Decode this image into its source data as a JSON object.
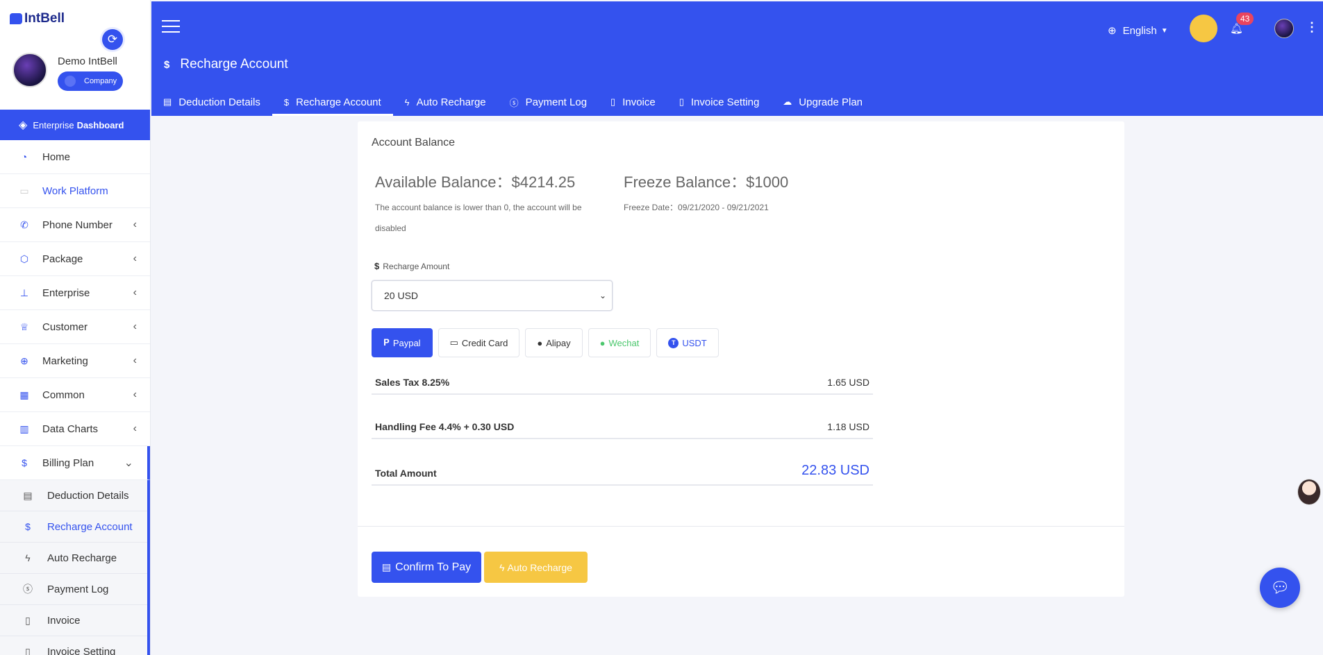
{
  "brand": {
    "name": "IntBell"
  },
  "profile": {
    "name": "Demo IntBell",
    "role": "Company"
  },
  "dashboard": {
    "prefix": "Enterprise",
    "bold": "Dashboard"
  },
  "sidebar": {
    "items": [
      {
        "label": "Home",
        "icon": "home-gauge-icon"
      },
      {
        "label": "Work Platform",
        "icon": "monitor-icon"
      },
      {
        "label": "Phone Number",
        "icon": "phone-icon"
      },
      {
        "label": "Package",
        "icon": "box-icon"
      },
      {
        "label": "Enterprise",
        "icon": "org-chart-icon"
      },
      {
        "label": "Customer",
        "icon": "crown-icon"
      },
      {
        "label": "Marketing",
        "icon": "target-icon"
      },
      {
        "label": "Common",
        "icon": "grid-icon"
      },
      {
        "label": "Data Charts",
        "icon": "bar-chart-icon"
      },
      {
        "label": "Billing Plan",
        "icon": "dollar-circle-icon"
      }
    ],
    "billing_sub": [
      {
        "label": "Deduction Details",
        "icon": "receipt-icon"
      },
      {
        "label": "Recharge Account",
        "icon": "dollar-icon"
      },
      {
        "label": "Auto Recharge",
        "icon": "bolt-icon"
      },
      {
        "label": "Payment Log",
        "icon": "dollar-circle-icon"
      },
      {
        "label": "Invoice",
        "icon": "invoice-icon"
      },
      {
        "label": "Invoice Setting",
        "icon": "invoice-icon"
      }
    ]
  },
  "header": {
    "page_title": "Recharge Account",
    "language": "English",
    "notifications": "43",
    "tabs": [
      {
        "label": "Deduction Details",
        "icon": "receipt-icon"
      },
      {
        "label": "Recharge Account",
        "icon": "dollar-icon"
      },
      {
        "label": "Auto Recharge",
        "icon": "bolt-icon"
      },
      {
        "label": "Payment Log",
        "icon": "dollar-circle-icon"
      },
      {
        "label": "Invoice",
        "icon": "invoice-icon"
      },
      {
        "label": "Invoice Setting",
        "icon": "invoice-icon"
      },
      {
        "label": "Upgrade Plan",
        "icon": "cloud-icon"
      }
    ]
  },
  "account": {
    "title": "Account Balance",
    "available": "Available Balance：$4214.25",
    "freeze": "Freeze Balance：$1000",
    "note": "The account balance is lower than 0, the account will be disabled",
    "freeze_date": "Freeze Date：09/21/2020 - 09/21/2021"
  },
  "recharge": {
    "label": "Recharge Amount",
    "selected": "20 USD",
    "methods": [
      "Paypal",
      "Credit Card",
      "Alipay",
      "Wechat",
      "USDT"
    ],
    "fees": [
      {
        "label": "Sales Tax 8.25%",
        "value": "1.65 USD"
      },
      {
        "label": "Handling Fee 4.4% + 0.30 USD",
        "value": "1.18 USD"
      },
      {
        "label": "Total Amount",
        "value": "22.83 USD"
      }
    ],
    "confirm_label": "Confirm To Pay",
    "auto_label": "Auto Recharge"
  },
  "colors": {
    "primary": "#3452ee",
    "accent": "#f6c743",
    "badge": "#e9445f",
    "wechat": "#4cc76d"
  }
}
